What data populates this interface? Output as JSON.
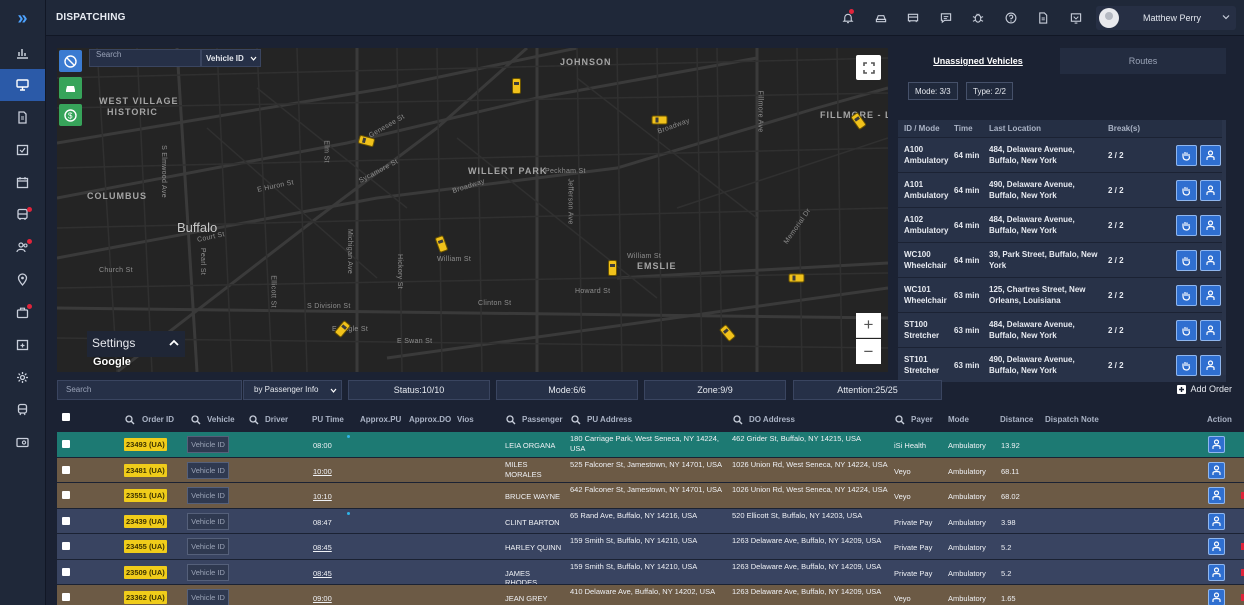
{
  "app": {
    "title": "DISPATCHING"
  },
  "sidebar": {
    "items": [
      {
        "icon": "chart-icon",
        "active": false,
        "badge": false
      },
      {
        "icon": "monitor-icon",
        "active": true,
        "badge": false
      },
      {
        "icon": "document-icon",
        "active": false,
        "badge": false
      },
      {
        "icon": "calendar-check-icon",
        "active": false,
        "badge": false
      },
      {
        "icon": "calendar-icon",
        "active": false,
        "badge": false
      },
      {
        "icon": "bus-icon",
        "active": false,
        "badge": true
      },
      {
        "icon": "users-icon",
        "active": false,
        "badge": true
      },
      {
        "icon": "location-icon",
        "active": false,
        "badge": false
      },
      {
        "icon": "briefcase-icon",
        "active": false,
        "badge": true
      },
      {
        "icon": "calendar-plus-icon",
        "active": false,
        "badge": false
      },
      {
        "icon": "gear-icon",
        "active": false,
        "badge": false
      },
      {
        "icon": "train-icon",
        "active": false,
        "badge": false
      },
      {
        "icon": "card-icon",
        "active": false,
        "badge": false
      }
    ]
  },
  "topbar": {
    "icons": [
      "bell-icon",
      "car-icon",
      "truck-icon",
      "chat-icon",
      "bug-icon",
      "help-icon",
      "file-icon",
      "cast-icon"
    ],
    "user": {
      "name": "Matthew Perry"
    }
  },
  "map": {
    "search_placeholder": "Search",
    "select_value": "Vehicle ID",
    "settings_label": "Settings",
    "attribution": "Google",
    "labels": {
      "west_village": "WEST VILLAGE",
      "historic": "HISTORIC",
      "johnson": "JOHNSON",
      "willert_park": "WILLERT PARK",
      "columbus": "COLUMBUS",
      "buffalo": "Buffalo",
      "emslie": "EMSLIE",
      "fillmore_leroy": "FILLMORE - LEROY",
      "genesee": "Genesee St",
      "broadway": "Broadway",
      "william": "William St",
      "sycamore": "Sycamore St",
      "clinton": "Clinton St",
      "jefferson": "Jefferson Ave",
      "howard": "Howard St",
      "peckham": "Peckham St",
      "memorial": "Memorial Dr",
      "fillmore": "Fillmore Ave",
      "eagle": "E Eagle St",
      "elmwood": "S Elmwood Ave",
      "church": "Church St",
      "pearl": "Pearl St",
      "ellicott": "Ellicott St",
      "elm": "Elm St",
      "michigan": "Michigan Ave",
      "hickory": "Hickory St",
      "huron": "E Huron St",
      "court": "Court St",
      "swan": "E Swan St",
      "seneca": "S Division St"
    }
  },
  "right_panel": {
    "tabs": [
      "Unassigned Vehicles",
      "Routes"
    ],
    "filters": [
      "Mode: 3/3",
      "Type: 2/2"
    ],
    "columns": [
      "ID / Mode",
      "Time",
      "Last Location",
      "Break(s)"
    ],
    "vehicles": [
      {
        "id": "A100",
        "mode": "Ambulatory",
        "time": "64 min",
        "location": "484, Delaware Avenue, Buffalo, New York",
        "breaks": "2 / 2"
      },
      {
        "id": "A101",
        "mode": "Ambulatory",
        "time": "64 min",
        "location": "490, Delaware Avenue, Buffalo, New York",
        "breaks": "2 / 2"
      },
      {
        "id": "A102",
        "mode": "Ambulatory",
        "time": "64 min",
        "location": "484, Delaware Avenue, Buffalo, New York",
        "breaks": "2 / 2"
      },
      {
        "id": "WC100",
        "mode": "Wheelchair",
        "time": "64 min",
        "location": "39, Park Street, Buffalo, New York",
        "breaks": "2 / 2"
      },
      {
        "id": "WC101",
        "mode": "Wheelchair",
        "time": "63 min",
        "location": "125, Chartres Street, New Orleans, Louisiana",
        "breaks": "2 / 2"
      },
      {
        "id": "ST100",
        "mode": "Stretcher",
        "time": "63 min",
        "location": "484, Delaware Avenue, Buffalo, New York",
        "breaks": "2 / 2"
      },
      {
        "id": "ST101",
        "mode": "Stretcher",
        "time": "63 min",
        "location": "490, Delaware Avenue, Buffalo, New York",
        "breaks": "2 / 2"
      }
    ]
  },
  "orders_toolbar": {
    "search_placeholder": "Search",
    "filter_select": "by Passenger Info",
    "status": "Status:10/10",
    "mode": "Mode:6/6",
    "zone": "Zone:9/9",
    "attention": "Attention:25/25",
    "add_order": "Add Order"
  },
  "orders": {
    "columns": {
      "order_id": "Order ID",
      "vehicle": "Vehicle",
      "driver": "Driver",
      "pu_time": "PU Time",
      "approx_pu": "Approx.PU",
      "approx_do": "Approx.DO",
      "vios": "Vios",
      "passenger": "Passenger",
      "pu_address": "PU Address",
      "do_address": "DO Address",
      "payer": "Payer",
      "mode": "Mode",
      "distance": "Distance",
      "dispatch_note": "Dispatch Note",
      "action": "Action"
    },
    "vehicle_placeholder": "Vehicle ID",
    "rows": [
      {
        "order_id": "23493 (UA)",
        "pu_time": "08:00",
        "passenger": "LEIA ORGANA",
        "pu_address": "180 Carriage Park, West Seneca, NY 14224, USA",
        "do_address": "462 Grider St, Buffalo, NY 14215, USA",
        "payer": "iSi Health",
        "mode": "Ambulatory",
        "distance": "13.92",
        "color": "#1d7a73",
        "dot": true,
        "underline": false,
        "edge": false
      },
      {
        "order_id": "23481 (UA)",
        "pu_time": "10:00",
        "passenger": "MILES MORALES",
        "pu_address": "525 Falconer St, Jamestown, NY 14701, USA",
        "do_address": "1026 Union Rd, West Seneca, NY 14224, USA",
        "payer": "Veyo",
        "mode": "Ambulatory",
        "distance": "68.11",
        "color": "#6c5a45",
        "dot": false,
        "underline": true,
        "edge": false
      },
      {
        "order_id": "23551 (UA)",
        "pu_time": "10:10",
        "passenger": "BRUCE WAYNE",
        "pu_address": "642 Falconer St, Jamestown, NY 14701, USA",
        "do_address": "1026 Union Rd, West Seneca, NY 14224, USA",
        "payer": "Veyo",
        "mode": "Ambulatory",
        "distance": "68.02",
        "color": "#6c5a45",
        "dot": false,
        "underline": true,
        "edge": true
      },
      {
        "order_id": "23439 (UA)",
        "pu_time": "08:47",
        "passenger": "CLINT BARTON",
        "pu_address": "65 Rand Ave, Buffalo, NY 14216, USA",
        "do_address": "520 Ellicott St, Buffalo, NY 14203, USA",
        "payer": "Private Pay",
        "mode": "Ambulatory",
        "distance": "3.98",
        "color": "#394461",
        "dot": true,
        "underline": false,
        "edge": false
      },
      {
        "order_id": "23455 (UA)",
        "pu_time": "08:45",
        "passenger": "HARLEY QUINN",
        "pu_address": "159 Smith St, Buffalo, NY 14210, USA",
        "do_address": "1263 Delaware Ave, Buffalo, NY 14209, USA",
        "payer": "Private Pay",
        "mode": "Ambulatory",
        "distance": "5.2",
        "color": "#394461",
        "dot": false,
        "underline": true,
        "edge": true
      },
      {
        "order_id": "23509 (UA)",
        "pu_time": "08:45",
        "passenger": "JAMES RHODES",
        "pu_address": "159 Smith St, Buffalo, NY 14210, USA",
        "do_address": "1263 Delaware Ave, Buffalo, NY 14209, USA",
        "payer": "Private Pay",
        "mode": "Ambulatory",
        "distance": "5.2",
        "color": "#394461",
        "dot": false,
        "underline": true,
        "edge": true
      },
      {
        "order_id": "23362 (UA)",
        "pu_time": "09:00",
        "passenger": "JEAN GREY",
        "pu_address": "410 Delaware Ave, Buffalo, NY 14202, USA",
        "do_address": "1263 Delaware Ave, Buffalo, NY 14209, USA",
        "payer": "Veyo",
        "mode": "Ambulatory",
        "distance": "1.65",
        "color": "#6c5a45",
        "dot": false,
        "underline": true,
        "edge": true
      }
    ]
  }
}
